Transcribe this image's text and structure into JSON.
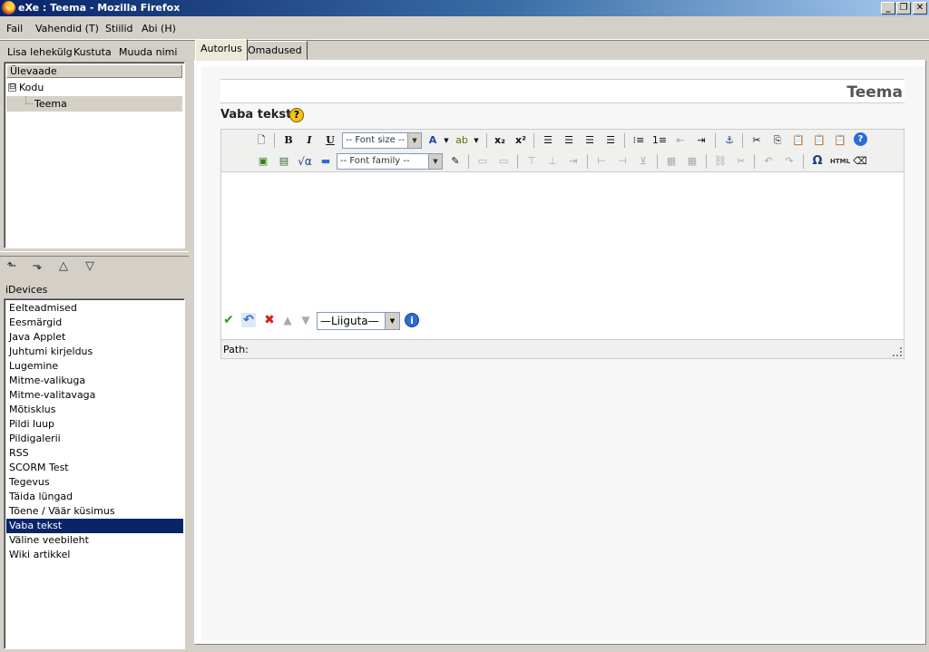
{
  "window": {
    "title": "eXe : Teema - Mozilla Firefox",
    "minimize_label": "_",
    "maximize_label": "❐",
    "close_label": "✕"
  },
  "menubar": {
    "items": [
      "Fail",
      "Vahendid (T)",
      "Stiilid",
      "Abi (H)"
    ]
  },
  "navbar": {
    "add_page": "Lisa lehekülg",
    "delete": "Kustuta",
    "rename": "Muuda nimi"
  },
  "tree": {
    "header": "Ülevaade",
    "root": "Kodu",
    "root_expander": "⊟",
    "child": "Teema"
  },
  "tree_arrows": [
    "⬑",
    "⬎",
    "△",
    "▽"
  ],
  "idevices": {
    "header": "iDevices",
    "items": [
      "Eelteadmised",
      "Eesmärgid",
      "Java Applet",
      "Juhtumi kirjeldus",
      "Lugemine",
      "Mitme-valikuga",
      "Mitme-valitavaga",
      "Mõtisklus",
      "Pildi luup",
      "Pildigalerii",
      "RSS",
      "SCORM Test",
      "Tegevus",
      "Täida lüngad",
      "Tõene / Väär küsimus",
      "Vaba tekst",
      "Väline veebileht",
      "Wiki artikkel"
    ],
    "selected": "Vaba tekst"
  },
  "tabs": [
    "Autorlus",
    "Omadused"
  ],
  "active_tab": "Autorlus",
  "page": {
    "title": "Teema"
  },
  "idevice": {
    "title": "Vaba tekst",
    "help_glyph": "?"
  },
  "editor": {
    "font_size_placeholder": "-- Font size --",
    "font_family_placeholder": "-- Font family --",
    "path_label": "Path:",
    "toolbar_row1": [
      "new-document",
      "bold",
      "italic",
      "underline",
      "font-size",
      "font-color",
      "highlight-color",
      "subscript",
      "superscript",
      "align-left",
      "align-center",
      "align-right",
      "align-justify",
      "bullet-list",
      "numbered-list",
      "outdent",
      "indent",
      "anchor",
      "cut",
      "copy",
      "paste",
      "paste-text",
      "paste-word",
      "help"
    ],
    "toolbar_row2": [
      "image",
      "media",
      "math",
      "horizontal-rule",
      "font-family",
      "edit-css",
      "table-row",
      "table-cell",
      "row-before",
      "row-after",
      "delete-row",
      "col-before",
      "col-after",
      "delete-col",
      "merge-cells",
      "split-cells",
      "link",
      "unlink",
      "undo",
      "redo",
      "special-char",
      "html-source",
      "eraser"
    ]
  },
  "actions": {
    "move_select": "—Liiguta—",
    "info_glyph": "i"
  },
  "colors": {
    "titlebar_start": "#0a246a",
    "titlebar_end": "#a6caf0",
    "selection": "#0a246a",
    "window_bg": "#d4d0c8"
  }
}
